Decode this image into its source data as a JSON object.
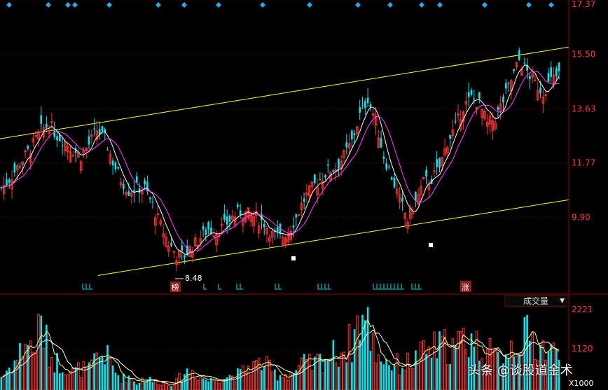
{
  "price_axis": {
    "ticks": [
      "17.37",
      "15.50",
      "13.63",
      "11.77",
      "9.90"
    ]
  },
  "volume_axis": {
    "ticks": [
      "2221",
      "1120"
    ],
    "multiplier": "X1000"
  },
  "annotations": {
    "low_price": "8.48",
    "rank_tag": "榜",
    "limit_up_tag": "涨"
  },
  "volume_selector": {
    "label": "成交量"
  },
  "watermark": {
    "text": "头条 @谈股道金术"
  },
  "colors": {
    "up": "#ff3232",
    "down": "#00e5ee",
    "ma_short": "#ffffff",
    "ma_long": "#ff44ff",
    "channel": "#ffff33",
    "axis": "#8b0000",
    "diamond": "#2aa8f0"
  },
  "chart_data": {
    "type": "candlestick",
    "price_axis_range": [
      7.5,
      17.37
    ],
    "volume_axis_range": [
      0,
      2600
    ],
    "channel_lines": [
      {
        "name": "upper",
        "start": 12.6,
        "end": 15.75
      },
      {
        "name": "lower",
        "start": 7.9,
        "end": 10.5
      }
    ],
    "close_path": [
      10.9,
      11.2,
      11.6,
      12.0,
      12.4,
      12.9,
      13.1,
      12.7,
      12.5,
      12.2,
      12.0,
      12.4,
      12.9,
      12.6,
      11.8,
      11.2,
      10.8,
      10.9,
      10.9,
      10.3,
      9.6,
      9.0,
      8.6,
      8.6,
      8.9,
      9.2,
      9.5,
      9.4,
      9.6,
      9.9,
      10.1,
      10.0,
      9.9,
      9.7,
      9.3,
      9.2,
      9.4,
      9.9,
      10.5,
      10.9,
      11.2,
      11.5,
      11.6,
      12.0,
      12.5,
      13.4,
      14.0,
      13.2,
      12.0,
      11.3,
      10.5,
      9.8,
      10.4,
      11.1,
      11.2,
      11.6,
      12.5,
      13.0,
      13.7,
      14.0,
      13.8,
      13.1,
      13.3,
      13.9,
      14.6,
      15.3,
      14.9,
      14.5,
      14.2,
      14.6,
      14.8
    ],
    "volume_path": [
      380,
      650,
      900,
      1450,
      1150,
      1900,
      1050,
      800,
      720,
      520,
      620,
      560,
      940,
      1050,
      650,
      320,
      400,
      210,
      360,
      260,
      230,
      180,
      240,
      520,
      560,
      380,
      270,
      330,
      380,
      420,
      460,
      650,
      720,
      780,
      500,
      450,
      460,
      560,
      760,
      700,
      860,
      980,
      1050,
      1180,
      1400,
      2140,
      1850,
      1100,
      920,
      760,
      720,
      780,
      880,
      1030,
      1190,
      1220,
      1300,
      1200,
      1450,
      1520,
      1220,
      1100,
      900,
      1050,
      1300,
      1480,
      1520,
      1350,
      1240,
      1100,
      1000
    ],
    "diamond_markers": 14
  }
}
